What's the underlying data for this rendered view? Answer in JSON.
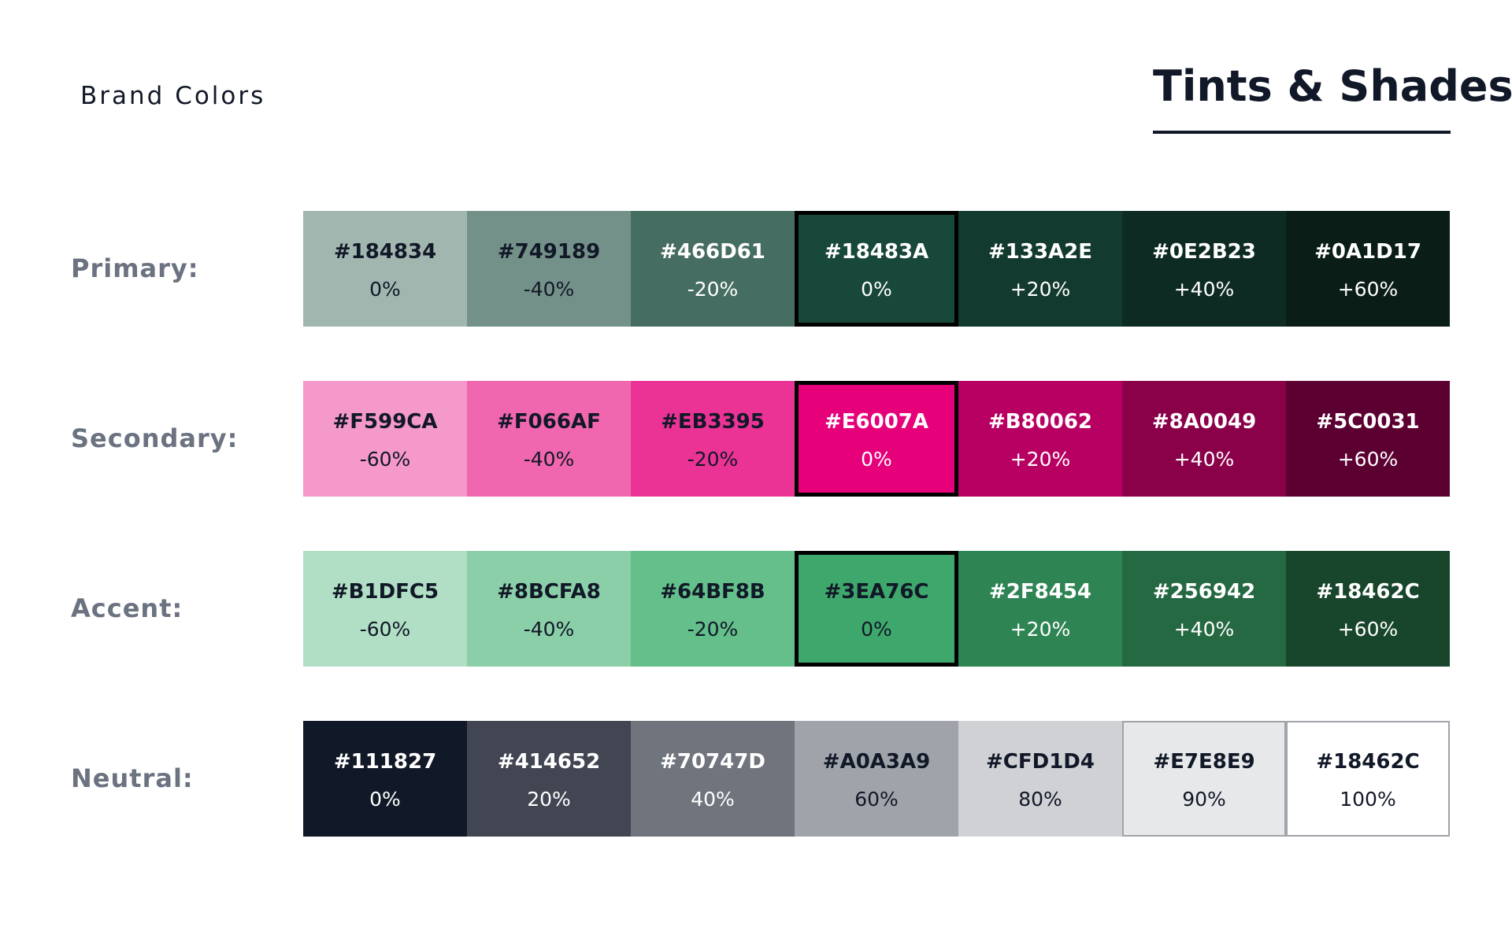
{
  "header": {
    "brand_label": "Brand Colors",
    "title": "Tints & Shades"
  },
  "palettes": [
    {
      "label": "Primary:",
      "swatches": [
        {
          "hex": "#184834",
          "percent": "0%",
          "color": "#A2B6B0",
          "text_color": "#111827"
        },
        {
          "hex": "#749189",
          "percent": "-40%",
          "color": "#749189",
          "text_color": "#111827"
        },
        {
          "hex": "#466D61",
          "percent": "-20%",
          "color": "#466D61",
          "text_color": "#ffffff"
        },
        {
          "hex": "#18483A",
          "percent": "0%",
          "color": "#18483A",
          "text_color": "#ffffff",
          "base": true
        },
        {
          "hex": "#133A2E",
          "percent": "+20%",
          "color": "#133A2E",
          "text_color": "#ffffff"
        },
        {
          "hex": "#0E2B23",
          "percent": "+40%",
          "color": "#0E2B23",
          "text_color": "#ffffff"
        },
        {
          "hex": "#0A1D17",
          "percent": "+60%",
          "color": "#0A1D17",
          "text_color": "#ffffff"
        }
      ]
    },
    {
      "label": "Secondary:",
      "swatches": [
        {
          "hex": "#F599CA",
          "percent": "-60%",
          "color": "#F599CA",
          "text_color": "#111827"
        },
        {
          "hex": "#F066AF",
          "percent": "-40%",
          "color": "#F066AF",
          "text_color": "#111827"
        },
        {
          "hex": "#EB3395",
          "percent": "-20%",
          "color": "#EB3395",
          "text_color": "#111827"
        },
        {
          "hex": "#E6007A",
          "percent": "0%",
          "color": "#E6007A",
          "text_color": "#ffffff",
          "base": true
        },
        {
          "hex": "#B80062",
          "percent": "+20%",
          "color": "#B80062",
          "text_color": "#ffffff"
        },
        {
          "hex": "#8A0049",
          "percent": "+40%",
          "color": "#8A0049",
          "text_color": "#ffffff"
        },
        {
          "hex": "#5C0031",
          "percent": "+60%",
          "color": "#5C0031",
          "text_color": "#ffffff"
        }
      ]
    },
    {
      "label": "Accent:",
      "swatches": [
        {
          "hex": "#B1DFC5",
          "percent": "-60%",
          "color": "#B1DFC5",
          "text_color": "#111827"
        },
        {
          "hex": "#8BCFA8",
          "percent": "-40%",
          "color": "#8BCFA8",
          "text_color": "#111827"
        },
        {
          "hex": "#64BF8B",
          "percent": "-20%",
          "color": "#64BF8B",
          "text_color": "#111827"
        },
        {
          "hex": "#3EA76C",
          "percent": "0%",
          "color": "#3EA76C",
          "text_color": "#111827",
          "base": true
        },
        {
          "hex": "#2F8454",
          "percent": "+20%",
          "color": "#2F8454",
          "text_color": "#ffffff"
        },
        {
          "hex": "#256942",
          "percent": "+40%",
          "color": "#256942",
          "text_color": "#ffffff"
        },
        {
          "hex": "#18462C",
          "percent": "+60%",
          "color": "#18462C",
          "text_color": "#ffffff"
        }
      ]
    },
    {
      "label": "Neutral:",
      "swatches": [
        {
          "hex": "#111827",
          "percent": "0%",
          "color": "#111827",
          "text_color": "#ffffff"
        },
        {
          "hex": "#414652",
          "percent": "20%",
          "color": "#414652",
          "text_color": "#ffffff"
        },
        {
          "hex": "#70747D",
          "percent": "40%",
          "color": "#70747D",
          "text_color": "#ffffff"
        },
        {
          "hex": "#A0A3A9",
          "percent": "60%",
          "color": "#A0A3A9",
          "text_color": "#111827"
        },
        {
          "hex": "#CFD1D4",
          "percent": "80%",
          "color": "#CFD1D4",
          "text_color": "#111827"
        },
        {
          "hex": "#E7E8E9",
          "percent": "90%",
          "color": "#E7E8E9",
          "text_color": "#111827",
          "outlined": true
        },
        {
          "hex": "#18462C",
          "percent": "100%",
          "color": "#FFFFFF",
          "text_color": "#111827",
          "outlined": true
        }
      ]
    }
  ]
}
